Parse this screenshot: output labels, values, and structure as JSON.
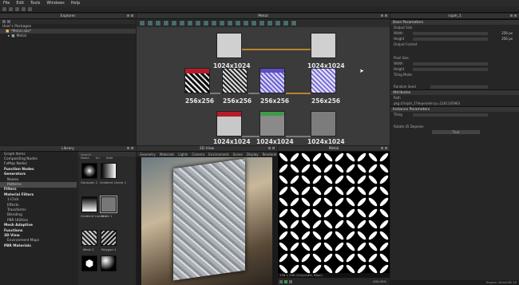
{
  "menu": [
    "File",
    "Edit",
    "Tools",
    "Windows",
    "Help"
  ],
  "explorer": {
    "title": "Explorer",
    "rows": [
      "User's Packages",
      "*Metal.sbs*",
      "Metal"
    ]
  },
  "graph": {
    "title": "Metal",
    "resolution_labels": [
      "1024x1024",
      "1024x1024",
      "256x256",
      "256x256",
      "256x256",
      "256x256",
      "1024x1024",
      "1024x1024",
      "1024x1024"
    ]
  },
  "params": {
    "title": "rajah_1",
    "sections": {
      "base": "Base Parameters",
      "attributes": "Attributes",
      "instance": "Instance Parameters"
    },
    "rows": {
      "output_size": "Output Size",
      "width": "Width",
      "height": "Height",
      "output_format": "Output Format",
      "pixel_size": "Pixel Size",
      "tiling_mode": "Tiling Mode",
      "random_seed": "Random Seed",
      "path": "Path",
      "path_value": "pkg:///rajah_1?dependency=1261145963",
      "tiling": "Tiling",
      "rotate": "Rotate 45 Degrees",
      "rotate_value": "True",
      "w_value": "256 px",
      "h_value": "256 px"
    },
    "status": "Engine: Direct3D 10"
  },
  "library": {
    "title": "Library",
    "search_placeholder": "Search",
    "items": [
      "Graph Items",
      "Compositing Nodes",
      "FxMap Nodes",
      "Function Nodes",
      "Generators",
      "Noises",
      "Patterns",
      "Filters",
      "Material Filters",
      "1-Click",
      "Effects",
      "Transforms",
      "Blending",
      "PBR Utilities",
      "Mesh Adaptive",
      "Functions",
      "3D View",
      "Environment Maps",
      "PBR Materials"
    ],
    "thumb_labels": [
      "Gaussian 2",
      "Gradient Linear 1",
      "Gradient Linear 2",
      "Mesh 1",
      "Mesh 2",
      "Polygon 1"
    ],
    "thumb_tabs": [
      "Name",
      "Url",
      "Date"
    ]
  },
  "view3d": {
    "title": "3D View",
    "tabs": [
      "Geometry",
      "Materials",
      "Lights",
      "Camera",
      "Environment",
      "Scene",
      "Display",
      "Renderer"
    ]
  },
  "view2d": {
    "title": "Metal",
    "footer": "256 x 256 (Grayscale, 8bpc)",
    "zoom": "400.00%"
  }
}
